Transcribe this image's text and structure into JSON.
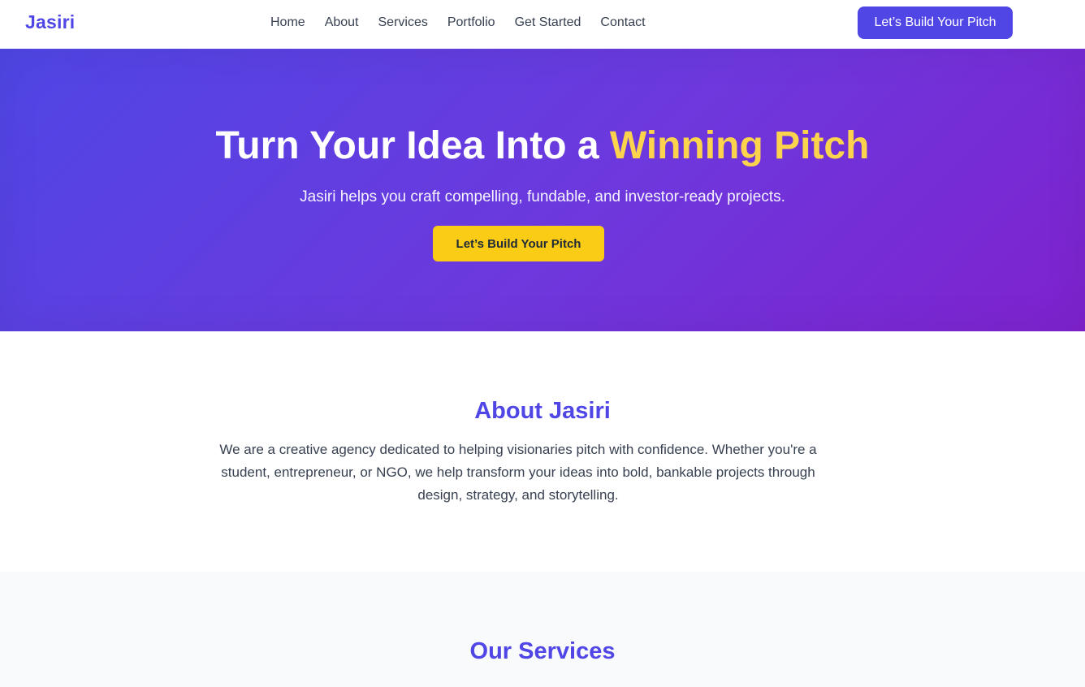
{
  "header": {
    "logo": "Jasiri",
    "nav": [
      "Home",
      "About",
      "Services",
      "Portfolio",
      "Get Started",
      "Contact"
    ],
    "cta_label": "Let’s Build Your Pitch"
  },
  "hero": {
    "title_prefix": "Turn Your Idea Into a ",
    "title_accent": "Winning Pitch",
    "subtitle": "Jasiri helps you craft compelling, fundable, and investor-ready projects.",
    "cta_label": "Let’s Build Your Pitch"
  },
  "about": {
    "title": "About Jasiri",
    "text": "We are a creative agency dedicated to helping visionaries pitch with confidence. Whether you're a student, entrepreneur, or NGO, we help transform your ideas into bold, bankable projects through design, strategy, and storytelling."
  },
  "services": {
    "title": "Our Services"
  },
  "colors": {
    "brand": "#4f46e5",
    "accent_yellow": "#facc15",
    "accent_text_yellow": "#fcd34d",
    "hero_gradient_start": "#4f46e5",
    "hero_gradient_end": "#7e22ce"
  }
}
